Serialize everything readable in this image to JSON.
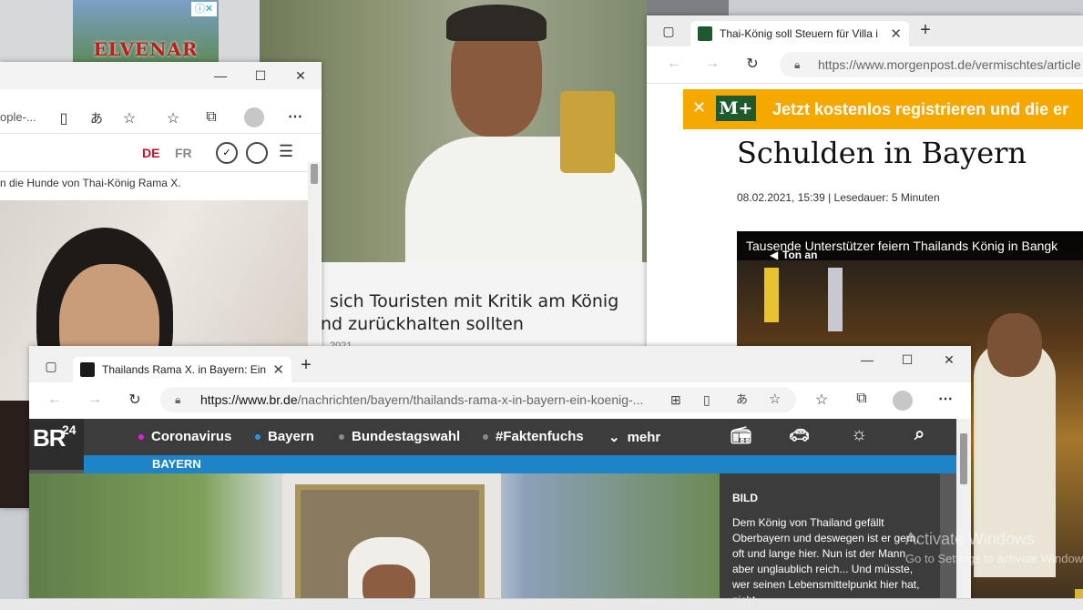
{
  "ad": {
    "brand": "ELVENAR"
  },
  "bg_article": {
    "headline_line1": "sich Touristen mit Kritik am König",
    "headline_line2": "nd zurückhalten sollten",
    "meta_partial": "2021"
  },
  "left_window": {
    "url_fragment": "ople-...",
    "lang_de": "DE",
    "lang_fr": "FR",
    "caption": "n die Hunde von Thai-König Rama X."
  },
  "morgenpost": {
    "tab_title": "Thai-König soll Steuern für Villa i",
    "url": "https://www.morgenpost.de/vermischtes/article",
    "banner_logo": "M+",
    "banner_text": "Jetzt kostenlos registrieren und die er",
    "headline": "Schulden in Bayern",
    "meta": "08.02.2021, 15:39 | Lesedauer: 5 Minuten",
    "video_caption": "Tausende Unterstützer feiern Thailands König in Bangk",
    "video_sound": "Ton an"
  },
  "br": {
    "tab_title": "Thailands Rama X. in Bayern: Ein",
    "url_domain": "https://www.br.de",
    "url_path": "/nachrichten/bayern/thailands-rama-x-in-bayern-ein-koenig-...",
    "logo": "BR",
    "logo_num": "24",
    "nav": {
      "coronavirus": "Coronavirus",
      "bayern": "Bayern",
      "bundestagswahl": "Bundestagswahl",
      "faktenfuchs": "#Faktenfuchs",
      "mehr": "mehr"
    },
    "section": "BAYERN",
    "sidebar_title": "BILD",
    "sidebar_text": "Dem König von Thailand gefällt Oberbayern und deswegen ist er gern, oft und lange hier. Nun ist der Mann aber unglaublich reich... Und müsste, wer seinen Lebensmittelpunkt hier hat, nicht"
  },
  "watermark": {
    "line1": "Activate Windows",
    "line2": "Go to Settings to activate Windows."
  },
  "colors": {
    "br_nav": "#3c3c3c",
    "br_blue": "#1d84c8",
    "mp_banner": "#f5a800",
    "mp_green": "#1f5a2e"
  }
}
